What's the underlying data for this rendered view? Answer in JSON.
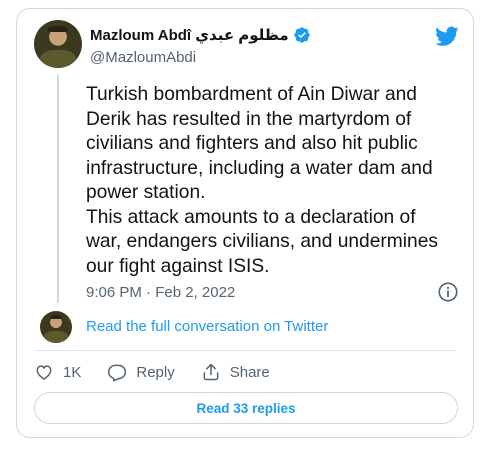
{
  "author": {
    "display_name": "Mazloum Abdî مظلوم عبدي",
    "handle": "@MazloumAbdi"
  },
  "tweet": {
    "text": "Turkish bombardment of Ain Diwar and\nDerik has resulted in the martyrdom of\ncivilians and fighters and also hit public\ninfrastructure, including a water dam and\npower station.\nThis attack amounts to a declaration of\nwar, endangers civilians, and undermines\nour fight against ISIS.",
    "timestamp": "9:06 PM · Feb 2, 2022"
  },
  "conversation_link": "Read the full conversation on Twitter",
  "actions": {
    "like_count": "1K",
    "reply_label": "Reply",
    "share_label": "Share"
  },
  "replies_button": "Read 33 replies",
  "colors": {
    "accent": "#1d9bf0",
    "secondary_text": "#536471",
    "border": "#cfd9de"
  },
  "icons": [
    "verified-badge-icon",
    "twitter-bird-icon",
    "info-icon",
    "heart-icon",
    "reply-icon",
    "share-icon"
  ]
}
